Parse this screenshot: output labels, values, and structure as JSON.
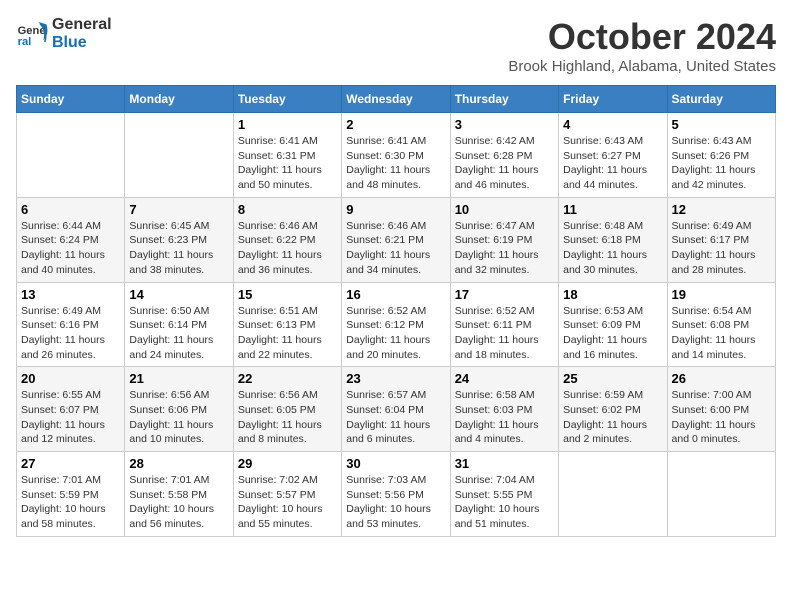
{
  "header": {
    "logo_line1": "General",
    "logo_line2": "Blue",
    "month": "October 2024",
    "location": "Brook Highland, Alabama, United States"
  },
  "days_of_week": [
    "Sunday",
    "Monday",
    "Tuesday",
    "Wednesday",
    "Thursday",
    "Friday",
    "Saturday"
  ],
  "weeks": [
    [
      {
        "day": "",
        "sunrise": "",
        "sunset": "",
        "daylight": ""
      },
      {
        "day": "",
        "sunrise": "",
        "sunset": "",
        "daylight": ""
      },
      {
        "day": "1",
        "sunrise": "Sunrise: 6:41 AM",
        "sunset": "Sunset: 6:31 PM",
        "daylight": "Daylight: 11 hours and 50 minutes."
      },
      {
        "day": "2",
        "sunrise": "Sunrise: 6:41 AM",
        "sunset": "Sunset: 6:30 PM",
        "daylight": "Daylight: 11 hours and 48 minutes."
      },
      {
        "day": "3",
        "sunrise": "Sunrise: 6:42 AM",
        "sunset": "Sunset: 6:28 PM",
        "daylight": "Daylight: 11 hours and 46 minutes."
      },
      {
        "day": "4",
        "sunrise": "Sunrise: 6:43 AM",
        "sunset": "Sunset: 6:27 PM",
        "daylight": "Daylight: 11 hours and 44 minutes."
      },
      {
        "day": "5",
        "sunrise": "Sunrise: 6:43 AM",
        "sunset": "Sunset: 6:26 PM",
        "daylight": "Daylight: 11 hours and 42 minutes."
      }
    ],
    [
      {
        "day": "6",
        "sunrise": "Sunrise: 6:44 AM",
        "sunset": "Sunset: 6:24 PM",
        "daylight": "Daylight: 11 hours and 40 minutes."
      },
      {
        "day": "7",
        "sunrise": "Sunrise: 6:45 AM",
        "sunset": "Sunset: 6:23 PM",
        "daylight": "Daylight: 11 hours and 38 minutes."
      },
      {
        "day": "8",
        "sunrise": "Sunrise: 6:46 AM",
        "sunset": "Sunset: 6:22 PM",
        "daylight": "Daylight: 11 hours and 36 minutes."
      },
      {
        "day": "9",
        "sunrise": "Sunrise: 6:46 AM",
        "sunset": "Sunset: 6:21 PM",
        "daylight": "Daylight: 11 hours and 34 minutes."
      },
      {
        "day": "10",
        "sunrise": "Sunrise: 6:47 AM",
        "sunset": "Sunset: 6:19 PM",
        "daylight": "Daylight: 11 hours and 32 minutes."
      },
      {
        "day": "11",
        "sunrise": "Sunrise: 6:48 AM",
        "sunset": "Sunset: 6:18 PM",
        "daylight": "Daylight: 11 hours and 30 minutes."
      },
      {
        "day": "12",
        "sunrise": "Sunrise: 6:49 AM",
        "sunset": "Sunset: 6:17 PM",
        "daylight": "Daylight: 11 hours and 28 minutes."
      }
    ],
    [
      {
        "day": "13",
        "sunrise": "Sunrise: 6:49 AM",
        "sunset": "Sunset: 6:16 PM",
        "daylight": "Daylight: 11 hours and 26 minutes."
      },
      {
        "day": "14",
        "sunrise": "Sunrise: 6:50 AM",
        "sunset": "Sunset: 6:14 PM",
        "daylight": "Daylight: 11 hours and 24 minutes."
      },
      {
        "day": "15",
        "sunrise": "Sunrise: 6:51 AM",
        "sunset": "Sunset: 6:13 PM",
        "daylight": "Daylight: 11 hours and 22 minutes."
      },
      {
        "day": "16",
        "sunrise": "Sunrise: 6:52 AM",
        "sunset": "Sunset: 6:12 PM",
        "daylight": "Daylight: 11 hours and 20 minutes."
      },
      {
        "day": "17",
        "sunrise": "Sunrise: 6:52 AM",
        "sunset": "Sunset: 6:11 PM",
        "daylight": "Daylight: 11 hours and 18 minutes."
      },
      {
        "day": "18",
        "sunrise": "Sunrise: 6:53 AM",
        "sunset": "Sunset: 6:09 PM",
        "daylight": "Daylight: 11 hours and 16 minutes."
      },
      {
        "day": "19",
        "sunrise": "Sunrise: 6:54 AM",
        "sunset": "Sunset: 6:08 PM",
        "daylight": "Daylight: 11 hours and 14 minutes."
      }
    ],
    [
      {
        "day": "20",
        "sunrise": "Sunrise: 6:55 AM",
        "sunset": "Sunset: 6:07 PM",
        "daylight": "Daylight: 11 hours and 12 minutes."
      },
      {
        "day": "21",
        "sunrise": "Sunrise: 6:56 AM",
        "sunset": "Sunset: 6:06 PM",
        "daylight": "Daylight: 11 hours and 10 minutes."
      },
      {
        "day": "22",
        "sunrise": "Sunrise: 6:56 AM",
        "sunset": "Sunset: 6:05 PM",
        "daylight": "Daylight: 11 hours and 8 minutes."
      },
      {
        "day": "23",
        "sunrise": "Sunrise: 6:57 AM",
        "sunset": "Sunset: 6:04 PM",
        "daylight": "Daylight: 11 hours and 6 minutes."
      },
      {
        "day": "24",
        "sunrise": "Sunrise: 6:58 AM",
        "sunset": "Sunset: 6:03 PM",
        "daylight": "Daylight: 11 hours and 4 minutes."
      },
      {
        "day": "25",
        "sunrise": "Sunrise: 6:59 AM",
        "sunset": "Sunset: 6:02 PM",
        "daylight": "Daylight: 11 hours and 2 minutes."
      },
      {
        "day": "26",
        "sunrise": "Sunrise: 7:00 AM",
        "sunset": "Sunset: 6:00 PM",
        "daylight": "Daylight: 11 hours and 0 minutes."
      }
    ],
    [
      {
        "day": "27",
        "sunrise": "Sunrise: 7:01 AM",
        "sunset": "Sunset: 5:59 PM",
        "daylight": "Daylight: 10 hours and 58 minutes."
      },
      {
        "day": "28",
        "sunrise": "Sunrise: 7:01 AM",
        "sunset": "Sunset: 5:58 PM",
        "daylight": "Daylight: 10 hours and 56 minutes."
      },
      {
        "day": "29",
        "sunrise": "Sunrise: 7:02 AM",
        "sunset": "Sunset: 5:57 PM",
        "daylight": "Daylight: 10 hours and 55 minutes."
      },
      {
        "day": "30",
        "sunrise": "Sunrise: 7:03 AM",
        "sunset": "Sunset: 5:56 PM",
        "daylight": "Daylight: 10 hours and 53 minutes."
      },
      {
        "day": "31",
        "sunrise": "Sunrise: 7:04 AM",
        "sunset": "Sunset: 5:55 PM",
        "daylight": "Daylight: 10 hours and 51 minutes."
      },
      {
        "day": "",
        "sunrise": "",
        "sunset": "",
        "daylight": ""
      },
      {
        "day": "",
        "sunrise": "",
        "sunset": "",
        "daylight": ""
      }
    ]
  ]
}
